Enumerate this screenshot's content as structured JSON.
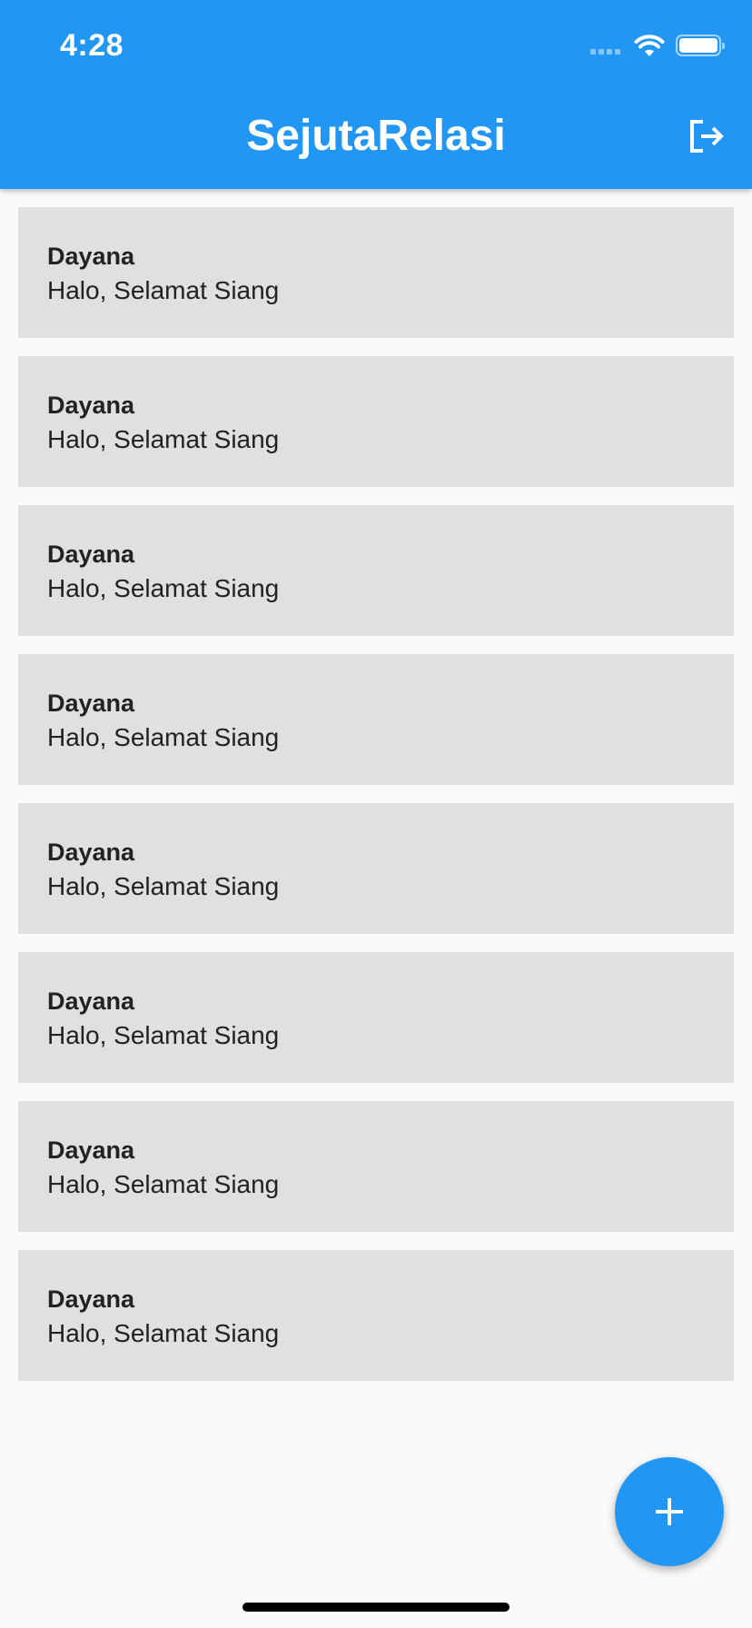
{
  "status_bar": {
    "time": "4:28",
    "icons": [
      "cellular-signal-icon",
      "wifi-icon",
      "battery-icon"
    ]
  },
  "app_bar": {
    "title": "SejutaRelasi",
    "logout_icon": "logout-icon",
    "background_color": "#2196f3"
  },
  "messages": [
    {
      "name": "Dayana",
      "text": "Halo, Selamat Siang"
    },
    {
      "name": "Dayana",
      "text": "Halo, Selamat Siang"
    },
    {
      "name": "Dayana",
      "text": "Halo, Selamat Siang"
    },
    {
      "name": "Dayana",
      "text": "Halo, Selamat Siang"
    },
    {
      "name": "Dayana",
      "text": "Halo, Selamat Siang"
    },
    {
      "name": "Dayana",
      "text": "Halo, Selamat Siang"
    },
    {
      "name": "Dayana",
      "text": "Halo, Selamat Siang"
    },
    {
      "name": "Dayana",
      "text": "Halo, Selamat Siang"
    }
  ],
  "fab": {
    "icon": "plus-icon",
    "color": "#2196f3"
  },
  "colors": {
    "card_background": "#e0e0e0",
    "page_background": "#fafafa"
  }
}
